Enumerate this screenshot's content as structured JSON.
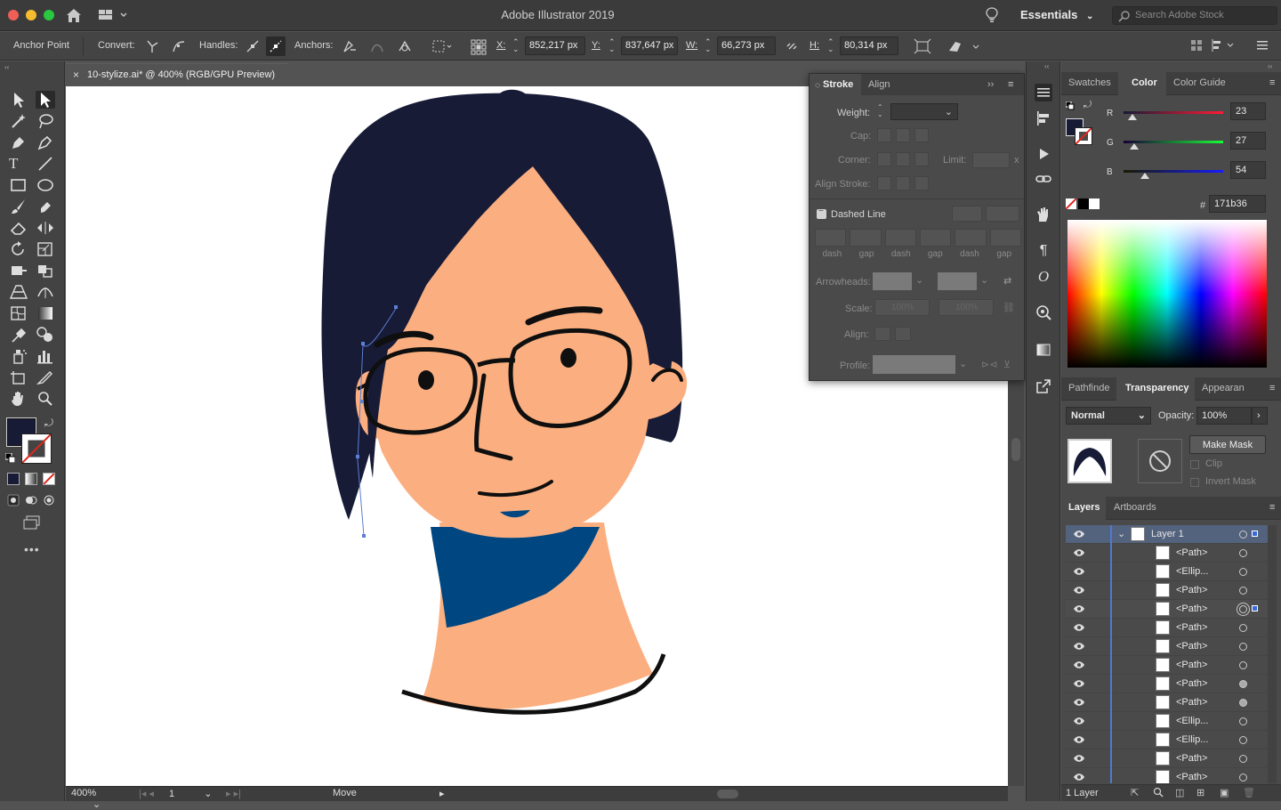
{
  "titlebar": {
    "app_title": "Adobe Illustrator 2019",
    "workspace": "Essentials",
    "stock_placeholder": "Search Adobe Stock"
  },
  "control": {
    "mode_label": "Anchor Point",
    "convert_label": "Convert:",
    "handles_label": "Handles:",
    "anchors_label": "Anchors:",
    "x_label": "X:",
    "x_value": "852,217 px",
    "y_label": "Y:",
    "y_value": "837,647 px",
    "w_label": "W:",
    "w_value": "66,273 px",
    "h_label": "H:",
    "h_value": "80,314 px"
  },
  "document": {
    "tab_title": "10-stylize.ai* @ 400% (RGB/GPU Preview)",
    "zoom": "400%",
    "artboard_num": "1",
    "status_text": "Move"
  },
  "stroke_panel": {
    "tabs": [
      "Stroke",
      "Align"
    ],
    "weight_label": "Weight:",
    "cap_label": "Cap:",
    "corner_label": "Corner:",
    "limit_label": "Limit:",
    "limit_suffix": "x",
    "align_stroke_label": "Align Stroke:",
    "dashed_line_label": "Dashed Line",
    "dash_labels": [
      "dash",
      "gap",
      "dash",
      "gap",
      "dash",
      "gap"
    ],
    "arrowheads_label": "Arrowheads:",
    "scale_label": "Scale:",
    "scale_value_1": "100%",
    "scale_value_2": "100%",
    "align_label": "Align:",
    "profile_label": "Profile:"
  },
  "color_panel": {
    "tabs": [
      "Swatches",
      "Color",
      "Color Guide"
    ],
    "r_label": "R",
    "r_value": "23",
    "g_label": "G",
    "g_value": "27",
    "b_label": "B",
    "b_value": "54",
    "hex_label": "#",
    "hex_value": "171b36",
    "fill_color": "#171b36"
  },
  "transparency_panel": {
    "tabs": [
      "Pathfinde",
      "Transparency",
      "Appearan"
    ],
    "blend_mode": "Normal",
    "opacity_label": "Opacity:",
    "opacity_value": "100%",
    "make_mask": "Make Mask",
    "clip": "Clip",
    "invert_mask": "Invert Mask"
  },
  "layers_panel": {
    "tabs": [
      "Layers",
      "Artboards"
    ],
    "layer_name": "Layer 1",
    "items": [
      "<Path>",
      "<Ellip...",
      "<Path>",
      "<Path>",
      "<Path>",
      "<Path>",
      "<Path>",
      "<Path>",
      "<Path>",
      "<Ellip...",
      "<Ellip...",
      "<Path>",
      "<Path>"
    ],
    "footer_count": "1 Layer"
  },
  "icons": {
    "home": "home-icon",
    "lightbulb": "lightbulb-icon",
    "search": "search-icon",
    "eye": "eye-icon"
  }
}
